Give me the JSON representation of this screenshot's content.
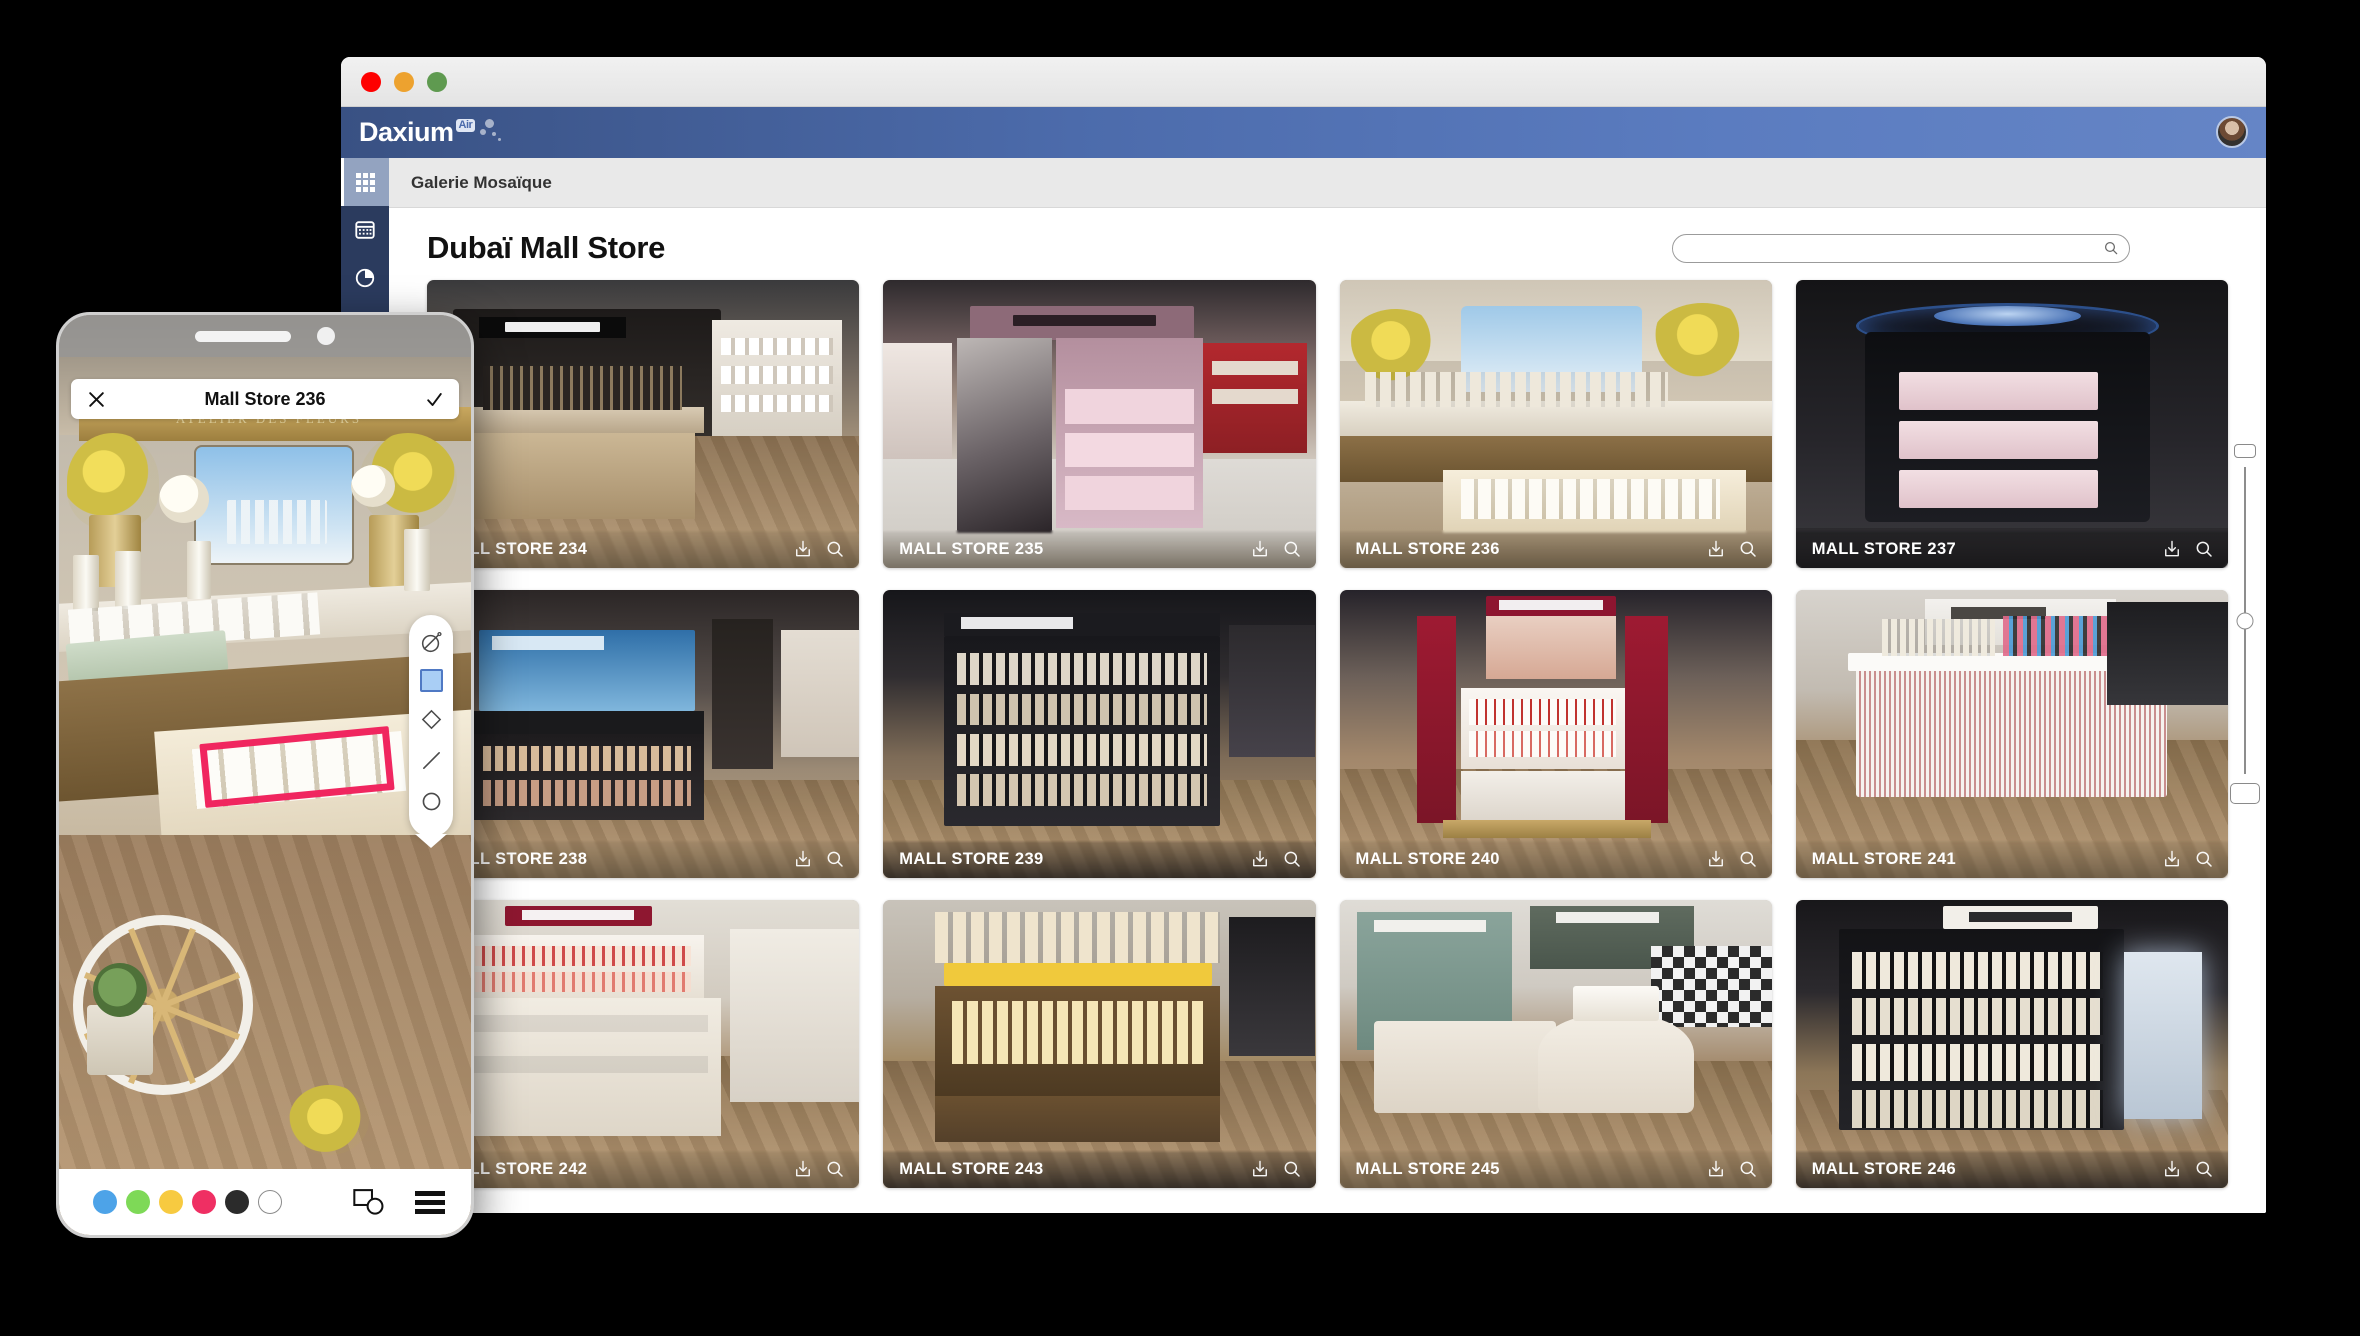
{
  "window": {
    "traffic_lights": [
      "close",
      "minimize",
      "maximize"
    ]
  },
  "appbar": {
    "brand": "Daxium",
    "brand_suffix": "Air",
    "avatar_name": "user-avatar",
    "brand_color": "#4c6bab"
  },
  "sidebar": {
    "items": [
      {
        "icon": "grid-icon",
        "label": "Galerie",
        "active": true
      },
      {
        "icon": "calendar-icon",
        "label": "Calendrier",
        "active": false
      },
      {
        "icon": "pie-chart-icon",
        "label": "Statistiques",
        "active": false
      }
    ]
  },
  "tabbar": {
    "label": "Galerie Mosaïque"
  },
  "main": {
    "page_title": "Dubaï Mall Store",
    "search": {
      "value": "",
      "placeholder": ""
    }
  },
  "size_slider": {
    "small_label": "small-thumbnail",
    "large_label": "large-thumbnail",
    "value_percent": 50
  },
  "tiles": [
    {
      "caption": "MALL STORE 234",
      "scene": "mac-counter",
      "cap_style": "light"
    },
    {
      "caption": "MALL STORE 235",
      "scene": "kylie-kiosk",
      "cap_style": "light"
    },
    {
      "caption": "MALL STORE 236",
      "scene": "chloe-atelier",
      "cap_style": "light"
    },
    {
      "caption": "MALL STORE 237",
      "scene": "dark-round-kiosk",
      "cap_style": "dark"
    },
    {
      "caption": "MALL STORE 238",
      "scene": "blackup-stand",
      "cap_style": "light"
    },
    {
      "caption": "MALL STORE 239",
      "scene": "loreal-gondola",
      "cap_style": "dark"
    },
    {
      "caption": "MALL STORE 240",
      "scene": "my-clarins",
      "cap_style": "light"
    },
    {
      "caption": "MALL STORE 241",
      "scene": "gucci-counter",
      "cap_style": "light"
    },
    {
      "caption": "MALL STORE 242",
      "scene": "clarins-counter",
      "cap_style": "light"
    },
    {
      "caption": "MALL STORE 243",
      "scene": "acqua-di-parma",
      "cap_style": "dark"
    },
    {
      "caption": "MALL STORE 245",
      "scene": "diptyque-gucci",
      "cap_style": "light"
    },
    {
      "caption": "MALL STORE 246",
      "scene": "jo-malone",
      "cap_style": "dark"
    }
  ],
  "tile_icons": {
    "download": "download-icon",
    "zoom": "search-icon"
  },
  "phone": {
    "header_title": "Mall Store 236",
    "close_label": "close",
    "confirm_label": "validate",
    "tools": [
      {
        "name": "freehand-tool",
        "selected": false
      },
      {
        "name": "rectangle-tool",
        "selected": true
      },
      {
        "name": "diamond-tool",
        "selected": false
      },
      {
        "name": "line-tool",
        "selected": false
      },
      {
        "name": "ellipse-tool",
        "selected": false
      }
    ],
    "colors": [
      {
        "name": "blue",
        "hex": "#4da3e8"
      },
      {
        "name": "green",
        "hex": "#7ed957"
      },
      {
        "name": "yellow",
        "hex": "#f7ca40"
      },
      {
        "name": "pink",
        "hex": "#ef2f63"
      },
      {
        "name": "black",
        "hex": "#2b2b2b"
      },
      {
        "name": "white",
        "hex": "#ffffff"
      }
    ],
    "annotation_color": "#f0265f",
    "shapes_button": "shapes-icon",
    "menu_button": "hamburger-menu-icon"
  }
}
